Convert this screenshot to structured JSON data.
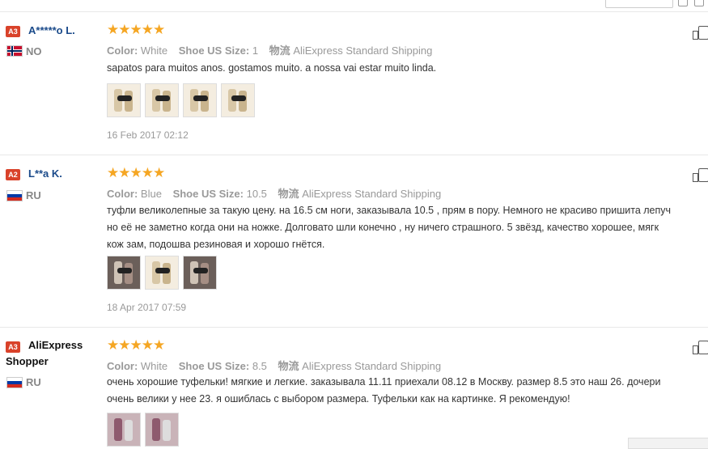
{
  "reviews": [
    {
      "level": "A3",
      "name": "A*****o L.",
      "country": "NO",
      "stars": "★★★★★",
      "color_label": "Color:",
      "color": "White",
      "size_label": "Shoe US Size:",
      "size": "1",
      "ship_label": "物流",
      "shipping": "AliExpress Standard Shipping",
      "text": [
        "sapatos para muitos anos. gostamos muito. a nossa vai estar muito linda."
      ],
      "photos": 4,
      "date": "16 Feb 2017 02:12"
    },
    {
      "level": "A2",
      "name": "L**a K.",
      "country": "RU",
      "stars": "★★★★★",
      "color_label": "Color:",
      "color": "Blue",
      "size_label": "Shoe US Size:",
      "size": "10.5",
      "ship_label": "物流",
      "shipping": "AliExpress Standard Shipping",
      "text": [
        "туфли великолепные за такую цену. на 16.5 см ноги, заказывала 10.5 , прям в пору. Немного не красиво пришита лепуч",
        "но её не заметно когда они на ножке. Долговато шли конечно , ну ничего страшного. 5 звёзд, качество хорошее, мягк",
        "кож зам, подошва резиновая и хорошо гнётся."
      ],
      "photos": 3,
      "date": "18 Apr 2017 07:59"
    },
    {
      "level": "A3",
      "name": "AliExpress Shopper",
      "name_line1": "AliExpress",
      "name_line2": "Shopper",
      "country": "RU",
      "stars": "★★★★★",
      "color_label": "Color:",
      "color": "White",
      "size_label": "Shoe US Size:",
      "size": "8.5",
      "ship_label": "物流",
      "shipping": "AliExpress Standard Shipping",
      "text": [
        "очень хорошие туфельки! мягкие и легкие. заказывала 11.11 приехали 08.12 в Москву. размер 8.5 это наш 26. дочери",
        "очень велики у нее 23. я ошиблась с выбором размера. Туфельки как на картинке. Я рекомендую!"
      ],
      "photos": 2
    }
  ],
  "icons": {
    "like": "thumbs-up-icon",
    "flag_no": "norway-flag-icon",
    "flag_ru": "russia-flag-icon"
  },
  "colors": {
    "level_badge": "#d9422a",
    "stars": "#f5a623",
    "username": "#1a4a8a"
  }
}
